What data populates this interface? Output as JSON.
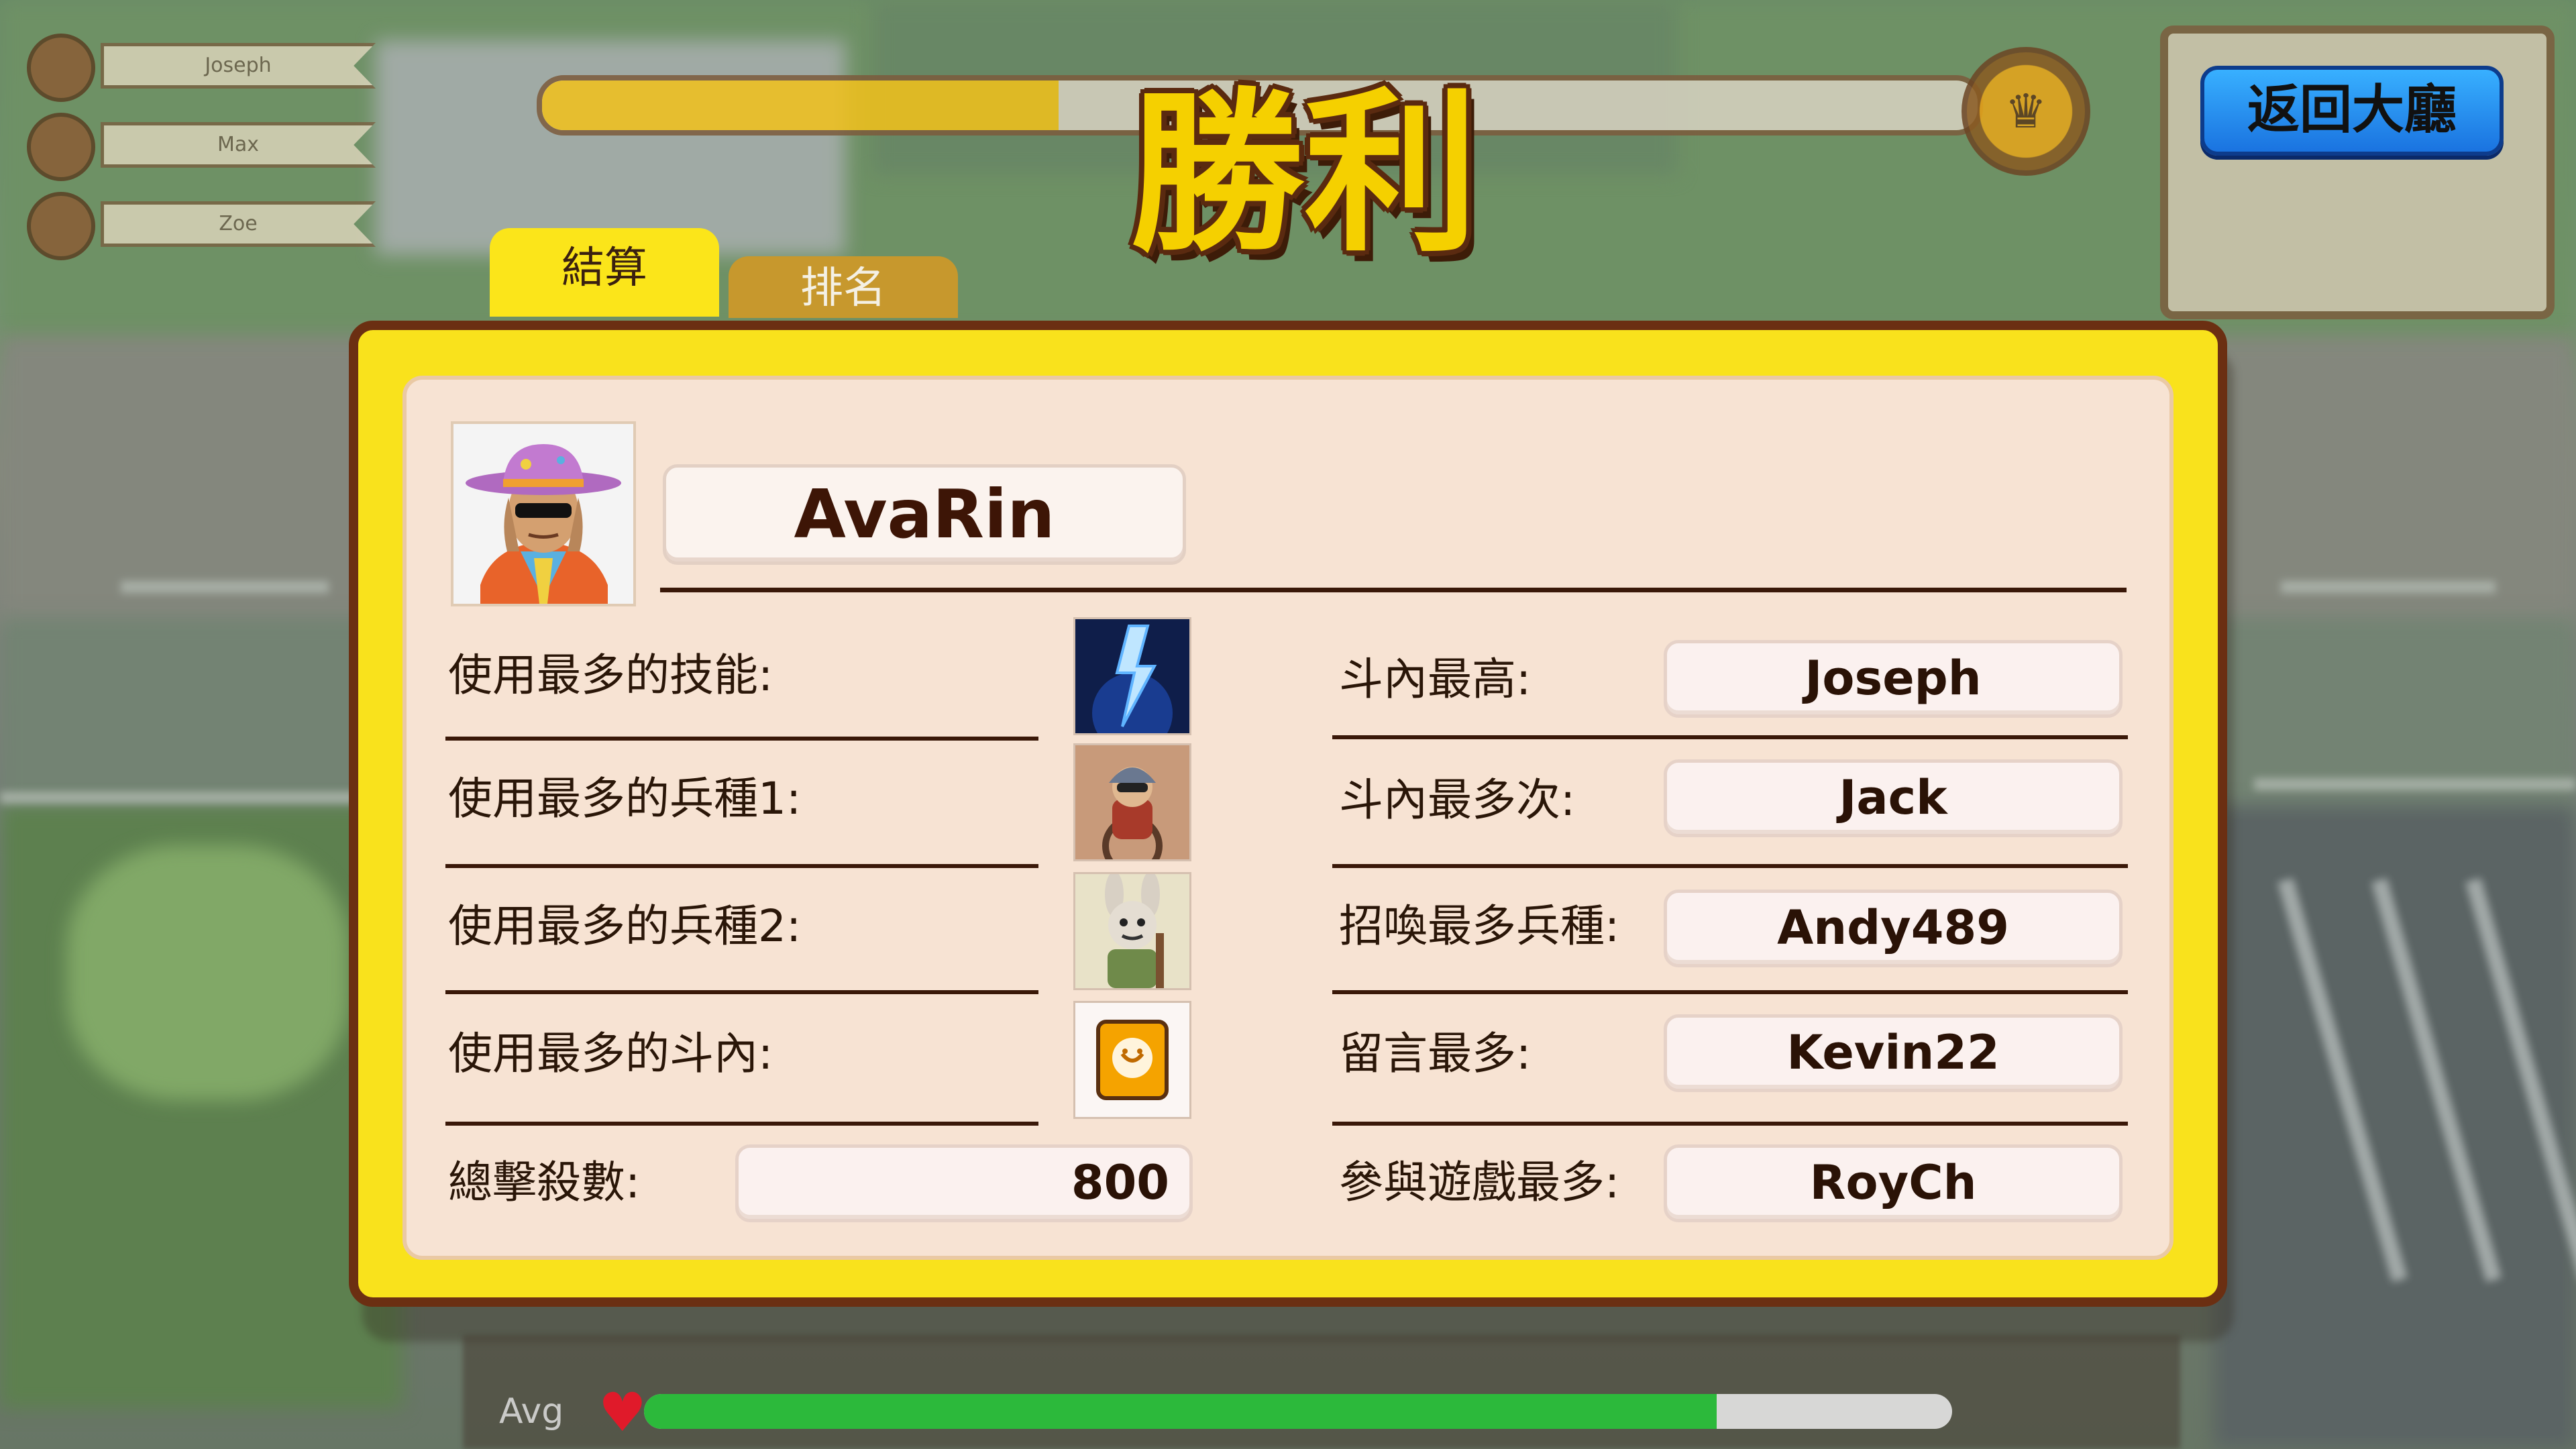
{
  "header": {
    "title": "勝利",
    "back_button": "返回大廳",
    "progress_fraction": 0.36
  },
  "players": [
    {
      "name": "Joseph"
    },
    {
      "name": "Max"
    },
    {
      "name": "Zoe"
    }
  ],
  "tabs": [
    {
      "label": "結算",
      "active": true
    },
    {
      "label": "排名",
      "active": false
    }
  ],
  "player": {
    "name": "AvaRin"
  },
  "left_stats": [
    {
      "label": "使用最多的技能:",
      "icon": "lightning-skill-icon"
    },
    {
      "label": "使用最多的兵種1:",
      "icon": "cyclist-unit-icon"
    },
    {
      "label": "使用最多的兵種2:",
      "icon": "rabbit-soldier-unit-icon"
    },
    {
      "label": "使用最多的斗內:",
      "icon": "donation-gift-icon"
    }
  ],
  "total_kills": {
    "label": "總擊殺數:",
    "value": "800"
  },
  "right_stats": [
    {
      "label": "斗內最高:",
      "value": "Joseph"
    },
    {
      "label": "斗內最多次:",
      "value": "Jack"
    },
    {
      "label": "招喚最多兵種:",
      "value": "Andy489"
    },
    {
      "label": "留言最多:",
      "value": "Kevin22"
    },
    {
      "label": "參與遊戲最多:",
      "value": "RoyCh"
    }
  ],
  "footer": {
    "hp_label": "Avg",
    "hp_fraction": 0.82
  },
  "colors": {
    "panel": "#f9e21c",
    "panel_border": "#6b2f12",
    "card": "#f7e3d3",
    "title": "#f5d000",
    "back_button": "#1a73e0",
    "hp": "#28c43a"
  }
}
